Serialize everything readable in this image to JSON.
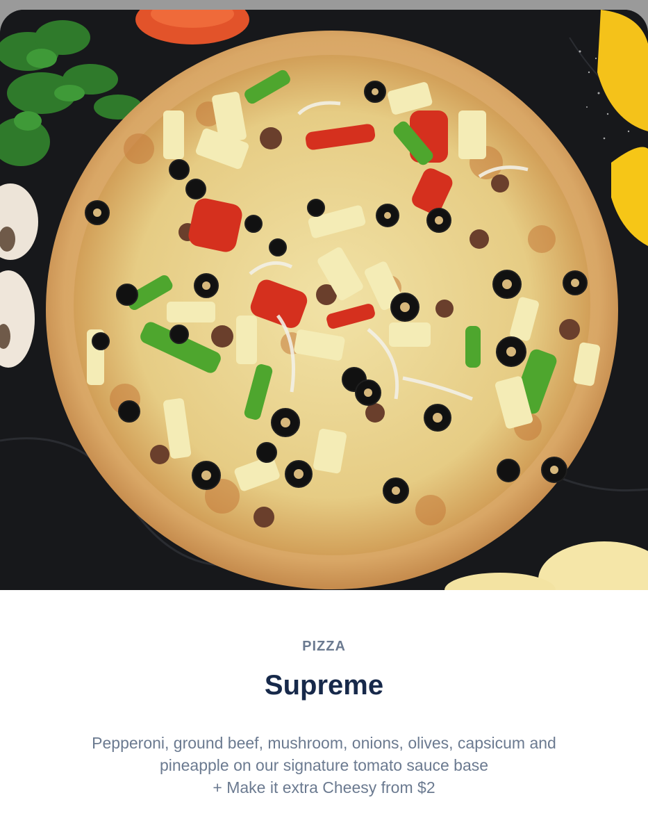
{
  "item": {
    "image_alt": "Supreme pizza topped with olives, peppers, pineapple and beef",
    "category": "PIZZA",
    "name": "Supreme",
    "description_lines": [
      "Pepperoni, ground beef, mushroom, onions, olives, capsicum and",
      "pineapple on our signature tomato sauce base",
      "+ Make it extra Cheesy from $2"
    ]
  },
  "colors": {
    "title": "#17294a",
    "muted_text": "#6b7a90",
    "background": "#ffffff",
    "hero_background": "#17181b"
  }
}
